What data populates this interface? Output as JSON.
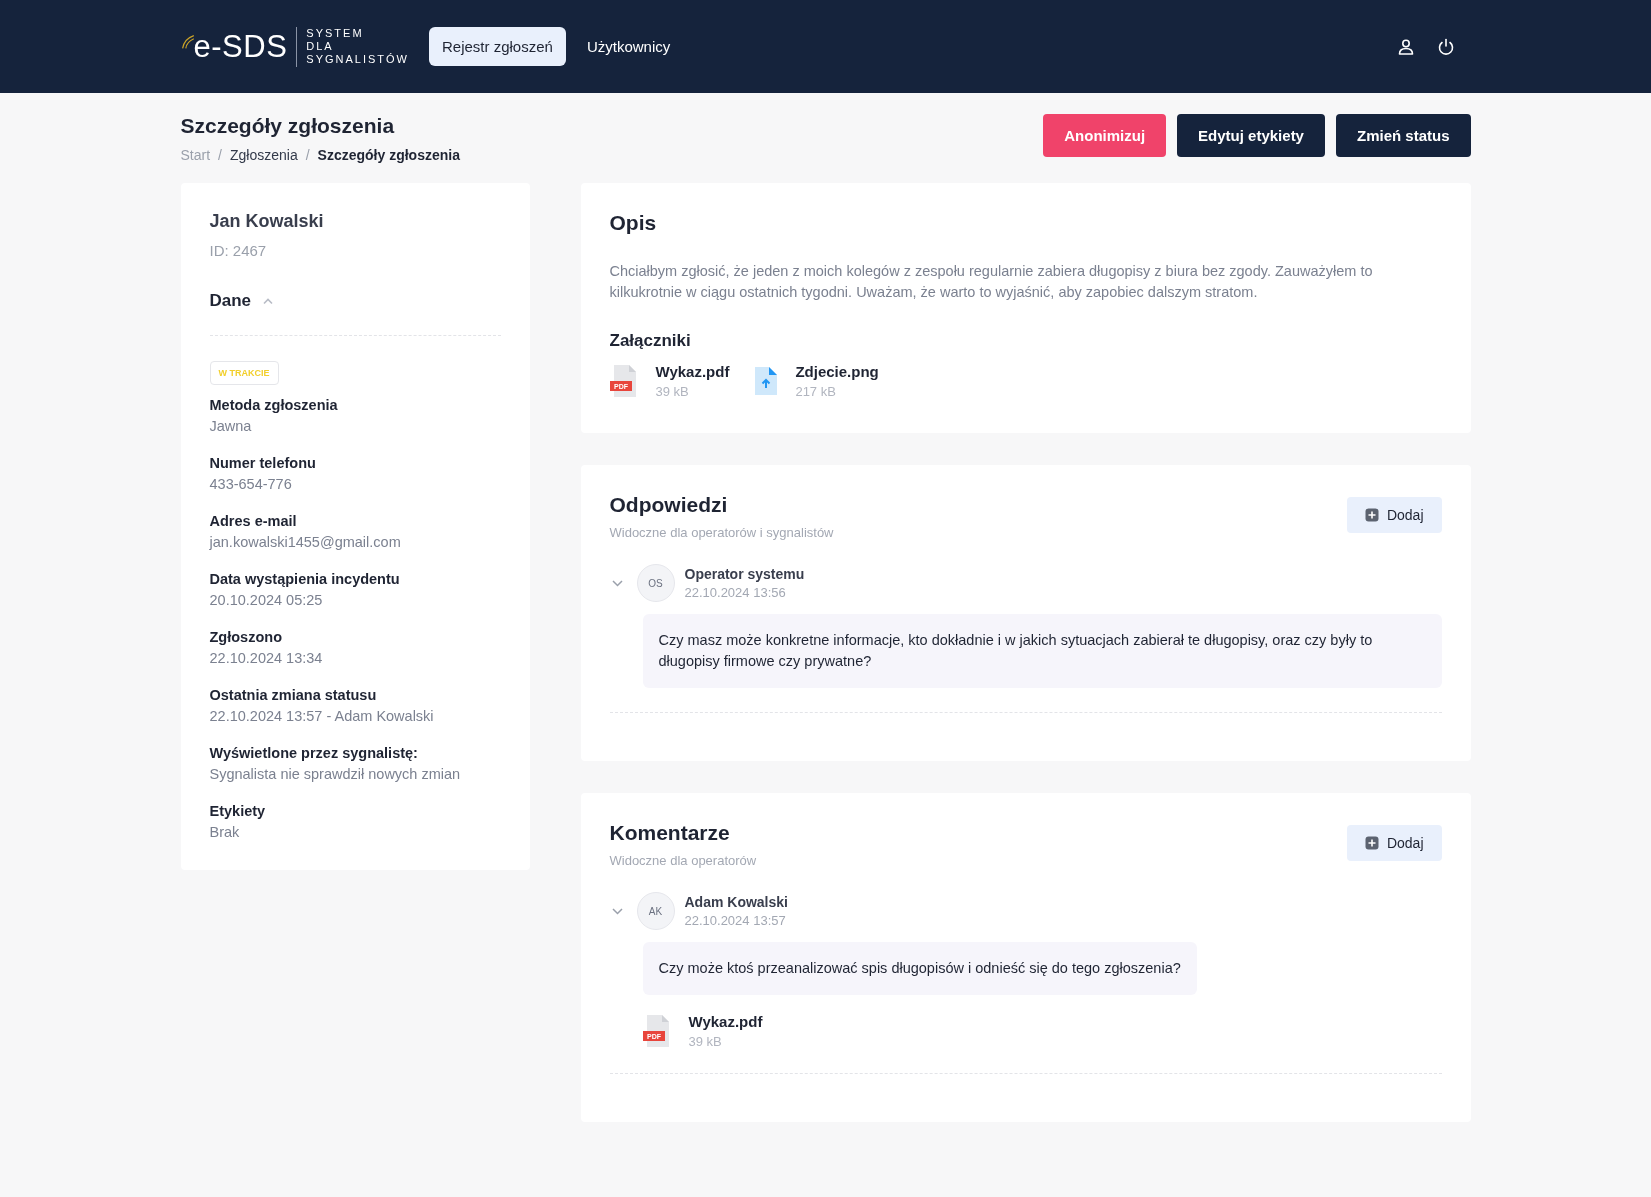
{
  "header": {
    "logo": {
      "mark": "e-SDS",
      "lines": [
        "SYSTEM",
        "DLA",
        "SYGNALISTÓW"
      ]
    },
    "nav": [
      {
        "label": "Rejestr zgłoszeń",
        "selected": true
      },
      {
        "label": "Użytkownicy",
        "selected": false
      }
    ]
  },
  "page": {
    "title": "Szczegóły zgłoszenia",
    "breadcrumb_separator": "/",
    "breadcrumb": [
      {
        "label": "Start",
        "current": false
      },
      {
        "label": "Zgłoszenia",
        "current": false
      },
      {
        "label": "Szczegóły zgłoszenia",
        "current": true
      }
    ],
    "actions": [
      {
        "label": "Anonimizuj",
        "kind": "danger"
      },
      {
        "label": "Edytuj etykiety",
        "kind": "dark"
      },
      {
        "label": "Zmień status",
        "kind": "dark"
      }
    ]
  },
  "person": {
    "name": "Jan Kowalski",
    "id": "ID: 2467",
    "section": {
      "title": "Dane",
      "expanded": true
    },
    "status": "W TRAKCIE",
    "fields": [
      {
        "label": "Metoda zgłoszenia",
        "value": "Jawna"
      },
      {
        "label": "Numer telefonu",
        "value": "433-654-776"
      },
      {
        "label": "Adres e-mail",
        "value": "jan.kowalski1455@gmail.com"
      },
      {
        "label": "Data wystąpienia incydentu",
        "value": "20.10.2024 05:25"
      },
      {
        "label": "Zgłoszono",
        "value": "22.10.2024 13:34"
      },
      {
        "label": "Ostatnia zmiana statusu",
        "value": "22.10.2024 13:57 - Adam Kowalski"
      },
      {
        "label": "Wyświetlone przez sygnalistę:",
        "value": "Sygnalista nie sprawdził nowych zmian"
      },
      {
        "label": "Etykiety",
        "value": "Brak"
      }
    ]
  },
  "description": {
    "title": "Opis",
    "text": "Chciałbym zgłosić, że jeden z moich kolegów z zespołu regularnie zabiera długopisy z biura bez zgody. Zauważyłem to kilkukrotnie w ciągu ostatnich tygodni. Uważam, że warto to wyjaśnić, aby zapobiec dalszym stratom.",
    "attachments_title": "Załączniki",
    "attachments": [
      {
        "kind": "pdf",
        "icon_label": "PDF",
        "name": "Wykaz.pdf",
        "size": "39 kB"
      },
      {
        "kind": "image",
        "name": "Zdjecie.png",
        "size": "217 kB"
      }
    ]
  },
  "threads": [
    {
      "title": "Odpowiedzi",
      "subtitle": "Widoczne dla operatorów i sygnalistów",
      "add_button": "Dodaj",
      "entries": [
        {
          "initials": "OS",
          "author": "Operator systemu",
          "time": "22.10.2024 13:56",
          "expanded": true,
          "message": "Czy masz może konkretne informacje, kto dokładnie i w jakich sytuacjach zabierał te długopisy, oraz czy były to długopisy firmowe czy prywatne?"
        }
      ]
    },
    {
      "title": "Komentarze",
      "subtitle": "Widoczne dla operatorów",
      "add_button": "Dodaj",
      "entries": [
        {
          "initials": "AK",
          "author": "Adam Kowalski",
          "time": "22.10.2024 13:57",
          "expanded": true,
          "message": "Czy może ktoś przeanalizować spis długopisów i odnieść się do tego zgłoszenia?",
          "attachments": [
            {
              "kind": "pdf",
              "icon_label": "PDF",
              "name": "Wykaz.pdf",
              "size": "39 kB"
            }
          ]
        }
      ]
    }
  ]
}
